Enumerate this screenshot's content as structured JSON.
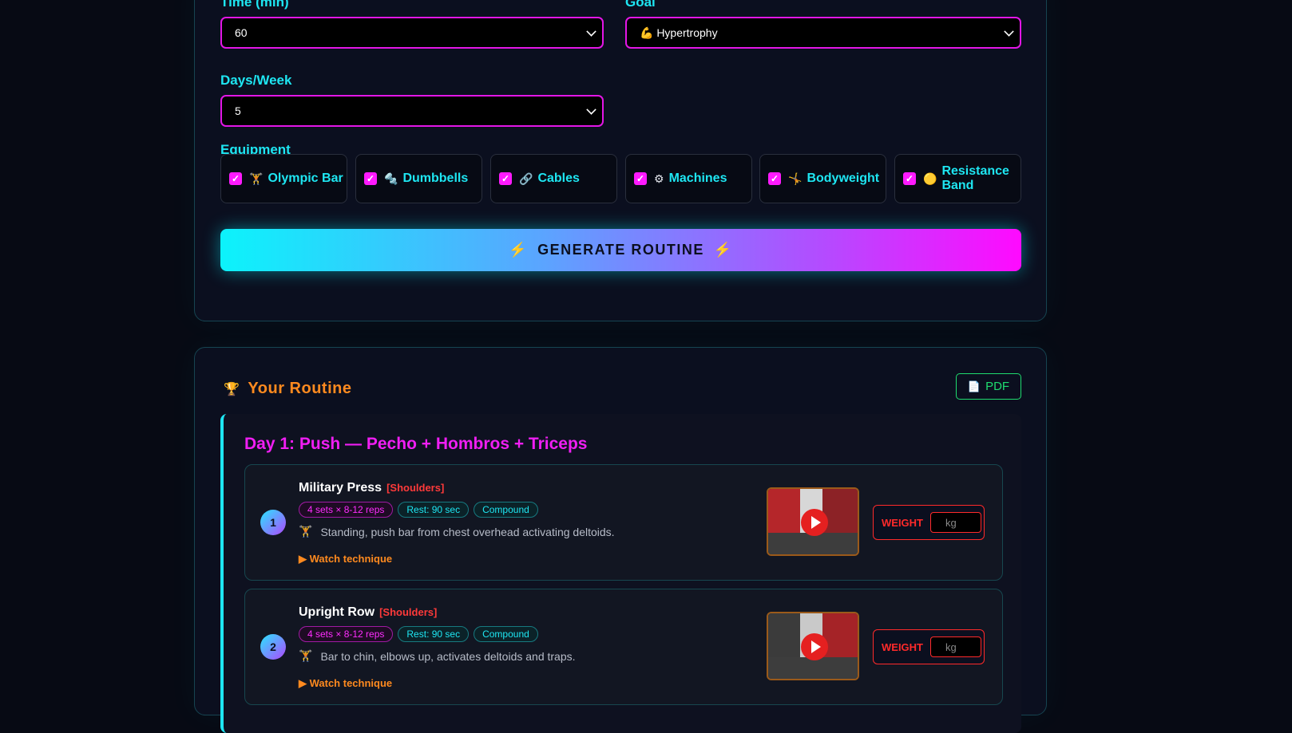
{
  "form": {
    "time_label": "Time (min)",
    "time_value": "60",
    "goal_label": "Goal",
    "goal_value": "💪 Hypertrophy",
    "days_label": "Days/Week",
    "days_value": "5",
    "equipment_label": "Equipment",
    "equipment": [
      {
        "icon": "🏋",
        "label": "Olympic Bar",
        "checked": true
      },
      {
        "icon": "🔩",
        "label": "Dumbbells",
        "checked": true
      },
      {
        "icon": "🔗",
        "label": "Cables",
        "checked": true
      },
      {
        "icon": "⚙",
        "label": "Machines",
        "checked": true
      },
      {
        "icon": "🤸",
        "label": "Bodyweight",
        "checked": true
      },
      {
        "icon": "🟡",
        "label": "Resistance Band",
        "checked": true
      }
    ],
    "generate_label": "GENERATE ROUTINE",
    "generate_icon": "⚡"
  },
  "routine": {
    "title": "Your Routine",
    "title_icon": "🏆",
    "pdf_label": "PDF",
    "pdf_icon": "📄",
    "day_title": "Day 1: Push — Pecho + Hombros + Triceps",
    "exercises": [
      {
        "number": "1",
        "name": "Military Press",
        "muscle": "[Shoulders]",
        "sets": "4 sets × 8-12 reps",
        "rest": "Rest: 90 sec",
        "type": "Compound",
        "icon": "🏋",
        "description": "Standing, push bar from chest overhead activating deltoids.",
        "watch": "▶ Watch technique",
        "weight_label": "WEIGHT",
        "weight_placeholder": "kg"
      },
      {
        "number": "2",
        "name": "Upright Row",
        "muscle": "[Shoulders]",
        "sets": "4 sets × 8-12 reps",
        "rest": "Rest: 90 sec",
        "type": "Compound",
        "icon": "🏋",
        "description": "Bar to chin, elbows up, activates deltoids and traps.",
        "watch": "▶ Watch technique",
        "weight_label": "WEIGHT",
        "weight_placeholder": "kg"
      }
    ]
  }
}
